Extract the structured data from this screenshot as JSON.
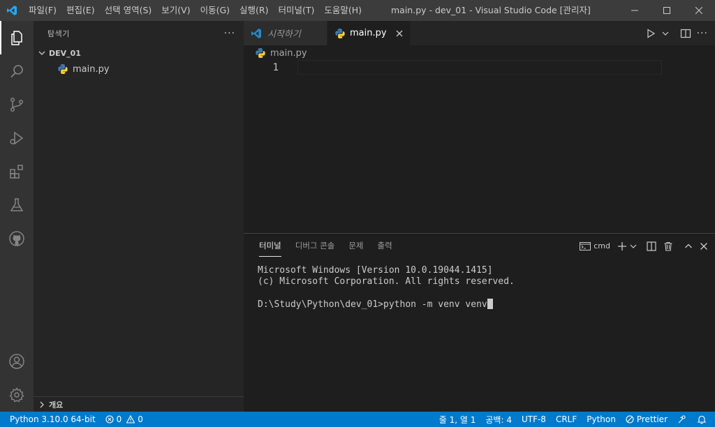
{
  "titlebar": {
    "menu": [
      "파일(F)",
      "편집(E)",
      "선택 영역(S)",
      "보기(V)",
      "이동(G)",
      "실행(R)",
      "터미널(T)",
      "도움말(H)"
    ],
    "title": "main.py - dev_01 - Visual Studio Code [관리자]"
  },
  "sidebar": {
    "title": "탐색기",
    "more": "···",
    "folder": "DEV_01",
    "files": [
      "main.py"
    ],
    "outline": "개요"
  },
  "editor": {
    "tabs": [
      {
        "label": "시작하기",
        "icon": "vscode-icon",
        "active": false
      },
      {
        "label": "main.py",
        "icon": "python-icon",
        "active": true
      }
    ],
    "breadcrumb": "main.py",
    "lines": [
      "1"
    ]
  },
  "panel": {
    "tabs": [
      "터미널",
      "디버그 콘솔",
      "문제",
      "출력"
    ],
    "terminal_name": "cmd",
    "terminal_lines": [
      "Microsoft Windows [Version 10.0.19044.1415]",
      "(c) Microsoft Corporation. All rights reserved.",
      "",
      "D:\\Study\\Python\\dev_01>python -m venv venv"
    ]
  },
  "statusbar": {
    "interpreter": "Python 3.10.0 64-bit",
    "errors": "0",
    "warnings": "0",
    "position": "줄 1, 열 1",
    "spaces": "공백: 4",
    "encoding": "UTF-8",
    "eol": "CRLF",
    "language": "Python",
    "prettier": "Prettier"
  },
  "colors": {
    "accent": "#007acc",
    "titlebar": "#3c3c3c",
    "activitybar": "#333333",
    "sidebar": "#252526",
    "editor": "#1e1e1e"
  }
}
